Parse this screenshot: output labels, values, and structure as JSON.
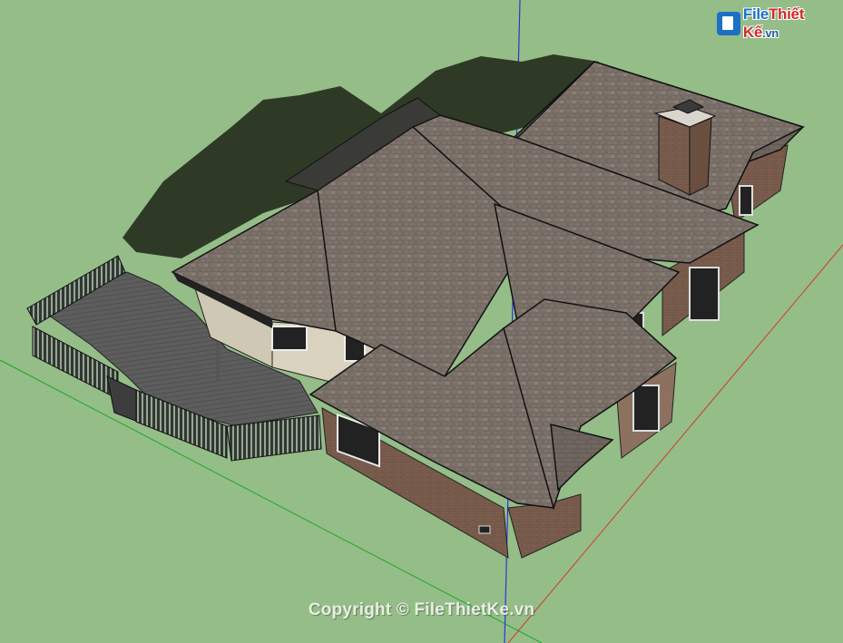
{
  "watermark": {
    "logo_file": "File",
    "logo_thiet": "Thiết",
    "logo_ke": "Kế",
    "logo_tld": ".vn",
    "copyright": "Copyright © FileThietKe.vn"
  },
  "scene": {
    "background_color": "#94bd88",
    "roof_color": "#7d736b",
    "axis_colors": {
      "red": "#d23a2a",
      "green": "#1ea82a",
      "blue": "#2a35d8"
    }
  }
}
